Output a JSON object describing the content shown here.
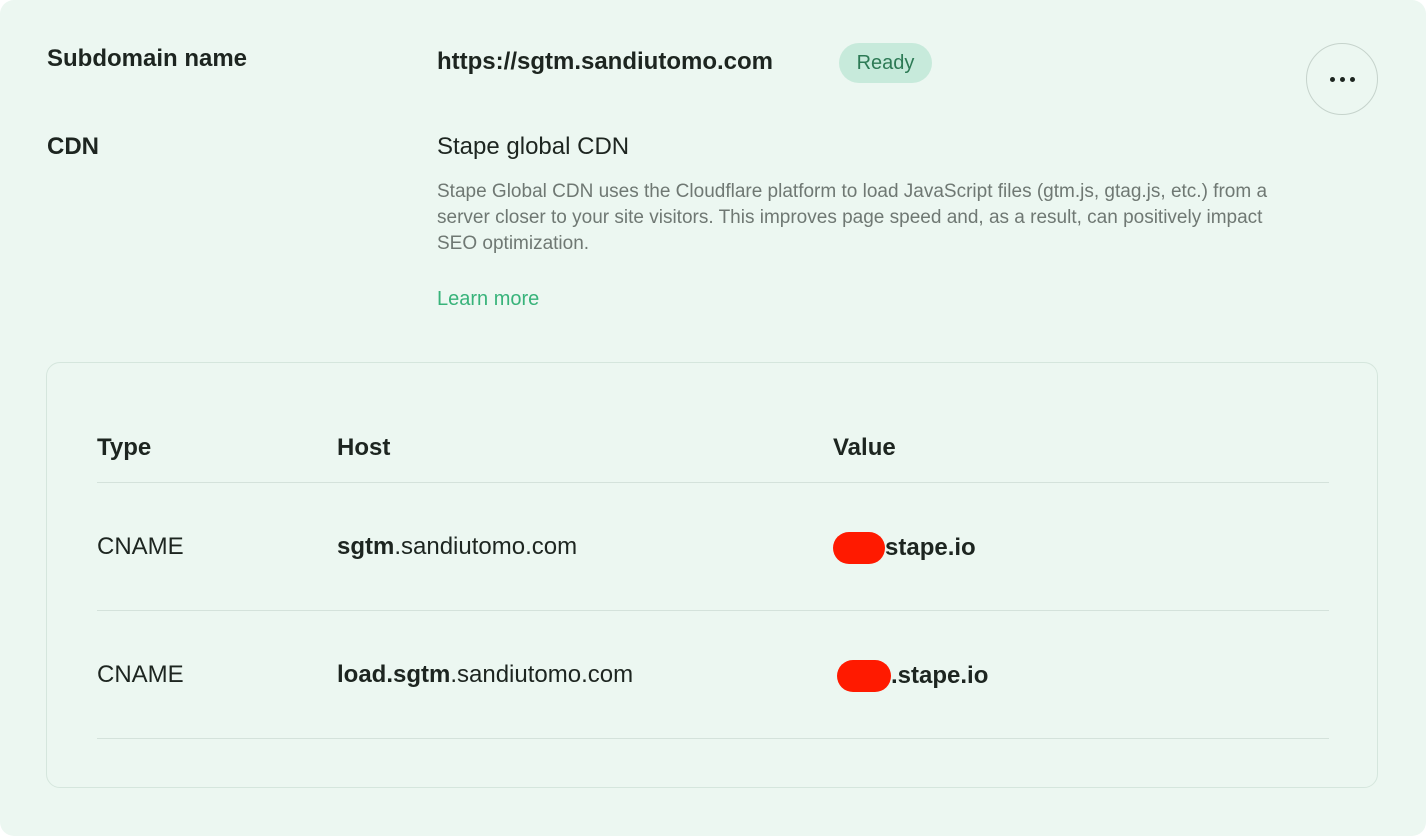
{
  "subdomain": {
    "label": "Subdomain name",
    "url": "https://sgtm.sandiutomo.com",
    "status": "Ready"
  },
  "more_button": {
    "icon": "more-horizontal-icon"
  },
  "cdn": {
    "label": "CDN",
    "name": "Stape global CDN",
    "description": "Stape Global CDN uses the Cloudflare platform to load JavaScript files (gtm.js, gtag.js, etc.) from a server closer to your site visitors. This improves page speed and, as a result, can positively impact SEO optimization.",
    "learn_more": "Learn more"
  },
  "dns_table": {
    "headers": {
      "type": "Type",
      "host": "Host",
      "value": "Value"
    },
    "rows": [
      {
        "type": "CNAME",
        "host_strong": "sgtm",
        "host_rest": ".sandiutomo.com",
        "value_suffix": "stape.io"
      },
      {
        "type": "CNAME",
        "host_strong": "load.sgtm",
        "host_rest": ".sandiutomo.com",
        "value_suffix": ".stape.io"
      }
    ]
  },
  "colors": {
    "card_background": "#ecf7f1",
    "badge_background": "#c7eadb",
    "badge_text": "#2d7a55",
    "link": "#38b37a",
    "redaction": "#ff1a00"
  }
}
